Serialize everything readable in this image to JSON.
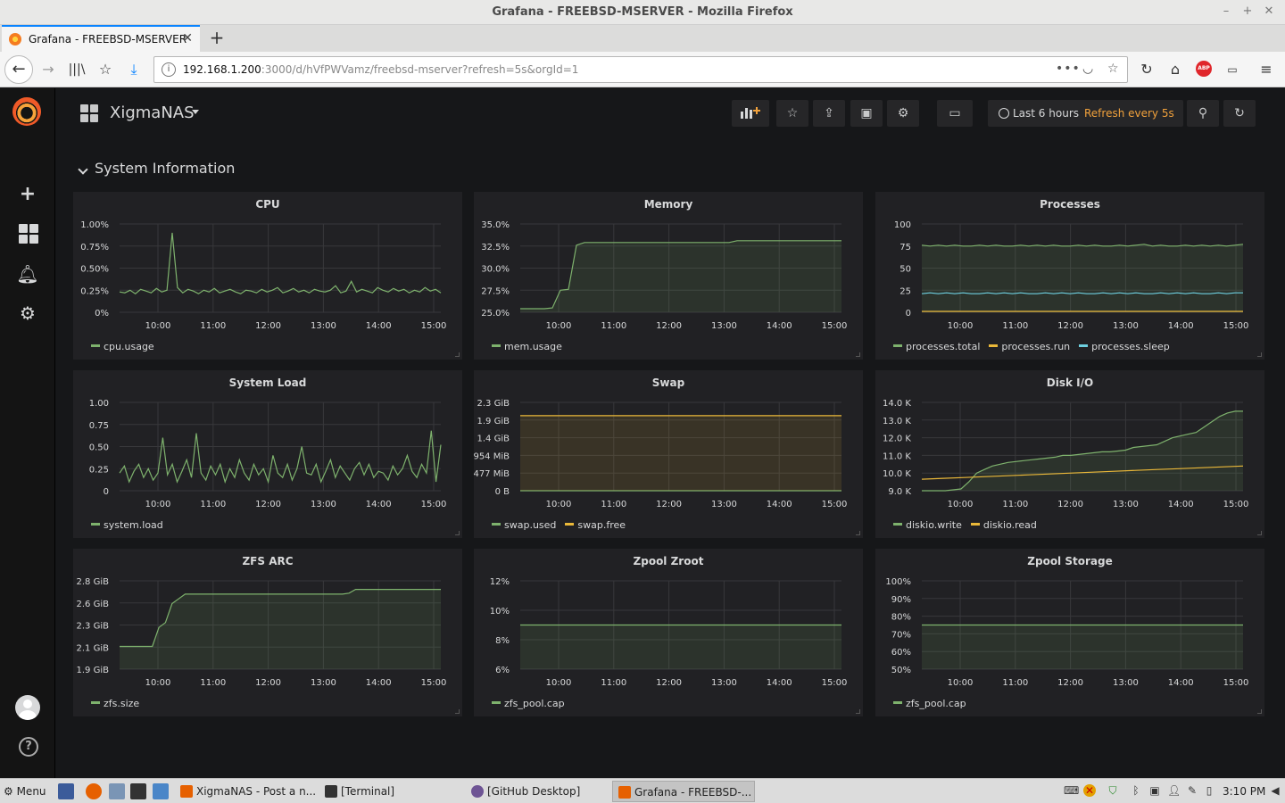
{
  "window": {
    "title": "Grafana - FREEBSD-MSERVER - Mozilla Firefox"
  },
  "tab": {
    "label": "Grafana - FREEBSD-MSERVER"
  },
  "url": {
    "host": "192.168.1.200",
    "rest": ":3000/d/hVfPWVamz/freebsd-mserver?refresh=5s&orgId=1"
  },
  "dashboard": {
    "title": "XigmaNAS",
    "time_range": "Last 6 hours",
    "refresh": "Refresh every 5s",
    "row_title": "System Information"
  },
  "time_ticks": [
    "10:00",
    "11:00",
    "12:00",
    "13:00",
    "14:00",
    "15:00"
  ],
  "panels": [
    {
      "title": "CPU",
      "legend": [
        "cpu.usage"
      ],
      "chart_data": {
        "type": "line",
        "y_ticks": [
          "1.00%",
          "0.75%",
          "0.50%",
          "0.25%",
          "0%"
        ],
        "ylim": [
          0,
          1.0
        ],
        "series": [
          {
            "name": "cpu.usage",
            "color": "#7eb26d",
            "fill": false,
            "values": [
              0.23,
              0.22,
              0.25,
              0.21,
              0.26,
              0.24,
              0.22,
              0.27,
              0.23,
              0.25,
              0.9,
              0.28,
              0.22,
              0.26,
              0.24,
              0.21,
              0.25,
              0.23,
              0.27,
              0.22,
              0.24,
              0.26,
              0.23,
              0.21,
              0.25,
              0.24,
              0.22,
              0.26,
              0.23,
              0.25,
              0.28,
              0.22,
              0.24,
              0.27,
              0.23,
              0.25,
              0.22,
              0.26,
              0.24,
              0.23,
              0.25,
              0.3,
              0.22,
              0.24,
              0.35,
              0.23,
              0.26,
              0.24,
              0.22,
              0.28,
              0.25,
              0.23,
              0.27,
              0.24,
              0.26,
              0.22,
              0.25,
              0.23,
              0.28,
              0.24,
              0.26,
              0.22
            ]
          }
        ]
      }
    },
    {
      "title": "Memory",
      "legend": [
        "mem.usage"
      ],
      "chart_data": {
        "type": "area",
        "y_ticks": [
          "35.0%",
          "32.5%",
          "30.0%",
          "27.5%",
          "25.0%"
        ],
        "ylim": [
          25,
          35
        ],
        "series": [
          {
            "name": "mem.usage",
            "color": "#7eb26d",
            "fill": true,
            "values": [
              25.4,
              25.4,
              25.4,
              25.4,
              25.5,
              27.5,
              27.6,
              32.6,
              32.9,
              32.9,
              32.9,
              32.9,
              32.9,
              32.9,
              32.9,
              32.9,
              32.9,
              32.9,
              32.9,
              32.9,
              32.9,
              32.9,
              32.9,
              32.9,
              32.9,
              32.9,
              32.9,
              33.1,
              33.1,
              33.1,
              33.1,
              33.1,
              33.1,
              33.1,
              33.1,
              33.1,
              33.1,
              33.1,
              33.1,
              33.1,
              33.1
            ]
          }
        ]
      }
    },
    {
      "title": "Processes",
      "legend": [
        "processes.total",
        "processes.run",
        "processes.sleep"
      ],
      "chart_data": {
        "type": "line",
        "y_ticks": [
          "100",
          "75",
          "50",
          "25",
          "0"
        ],
        "ylim": [
          0,
          100
        ],
        "series": [
          {
            "name": "processes.total",
            "color": "#7eb26d",
            "fill": true,
            "values": [
              76,
              75,
              76,
              75,
              76,
              75,
              75,
              76,
              75,
              76,
              75,
              75,
              76,
              75,
              76,
              75,
              76,
              75,
              75,
              76,
              75,
              76,
              75,
              75,
              76,
              75,
              76,
              77,
              75,
              76,
              75,
              75,
              76,
              75,
              76,
              75,
              76,
              75,
              76,
              77
            ]
          },
          {
            "name": "processes.run",
            "color": "#eab839",
            "fill": false,
            "values": [
              1,
              1,
              1,
              1,
              1,
              1,
              1,
              1,
              1,
              1,
              1,
              1,
              1,
              1,
              1,
              1,
              1,
              1,
              1,
              1,
              1,
              1,
              1,
              1,
              1,
              1,
              1,
              1,
              1,
              1,
              1,
              1,
              1,
              1,
              1,
              1,
              1,
              1,
              1,
              1
            ]
          },
          {
            "name": "processes.sleep",
            "color": "#6ed0e0",
            "fill": false,
            "values": [
              21,
              22,
              21,
              22,
              21,
              22,
              21,
              21,
              22,
              21,
              22,
              21,
              22,
              21,
              21,
              22,
              21,
              22,
              21,
              22,
              21,
              21,
              22,
              21,
              22,
              21,
              22,
              21,
              21,
              22,
              21,
              22,
              21,
              22,
              21,
              21,
              22,
              21,
              22,
              22
            ]
          }
        ]
      }
    },
    {
      "title": "System Load",
      "legend": [
        "system.load"
      ],
      "chart_data": {
        "type": "line",
        "y_ticks": [
          "1.00",
          "0.75",
          "0.50",
          "0.25",
          "0"
        ],
        "ylim": [
          0,
          1.0
        ],
        "series": [
          {
            "name": "system.load",
            "color": "#7eb26d",
            "fill": false,
            "values": [
              0.2,
              0.28,
              0.1,
              0.22,
              0.3,
              0.15,
              0.25,
              0.12,
              0.2,
              0.6,
              0.18,
              0.3,
              0.1,
              0.22,
              0.35,
              0.15,
              0.65,
              0.2,
              0.12,
              0.28,
              0.18,
              0.3,
              0.1,
              0.25,
              0.15,
              0.35,
              0.2,
              0.12,
              0.3,
              0.18,
              0.25,
              0.1,
              0.4,
              0.2,
              0.15,
              0.3,
              0.12,
              0.25,
              0.5,
              0.2,
              0.18,
              0.3,
              0.1,
              0.22,
              0.35,
              0.15,
              0.28,
              0.2,
              0.12,
              0.25,
              0.32,
              0.18,
              0.3,
              0.15,
              0.22,
              0.2,
              0.12,
              0.28,
              0.18,
              0.25,
              0.4,
              0.22,
              0.15,
              0.3,
              0.2,
              0.68,
              0.1,
              0.52
            ]
          }
        ]
      }
    },
    {
      "title": "Swap",
      "legend": [
        "swap.used",
        "swap.free"
      ],
      "chart_data": {
        "type": "area",
        "y_ticks": [
          "2.3 GiB",
          "1.9 GiB",
          "1.4 GiB",
          "954 MiB",
          "477 MiB",
          "0 B"
        ],
        "ylim": [
          0,
          2.33
        ],
        "series": [
          {
            "name": "swap.used",
            "color": "#7eb26d",
            "fill": false,
            "values": [
              0,
              0,
              0,
              0,
              0,
              0,
              0,
              0,
              0,
              0
            ]
          },
          {
            "name": "swap.free",
            "color": "#eab839",
            "fill": true,
            "values": [
              1.98,
              1.98,
              1.98,
              1.98,
              1.98,
              1.98,
              1.98,
              1.98,
              1.98,
              1.98
            ]
          }
        ]
      }
    },
    {
      "title": "Disk I/O",
      "legend": [
        "diskio.write",
        "diskio.read"
      ],
      "chart_data": {
        "type": "area",
        "y_ticks": [
          "14.0 K",
          "13.0 K",
          "12.0 K",
          "11.0 K",
          "10.0 K",
          "9.0 K"
        ],
        "ylim": [
          9000,
          14000
        ],
        "series": [
          {
            "name": "diskio.write",
            "color": "#7eb26d",
            "fill": true,
            "values": [
              9000,
              9000,
              9000,
              9000,
              9050,
              9100,
              9500,
              10000,
              10200,
              10400,
              10500,
              10600,
              10650,
              10700,
              10750,
              10800,
              10850,
              10900,
              11000,
              11000,
              11050,
              11100,
              11150,
              11200,
              11200,
              11250,
              11300,
              11450,
              11500,
              11550,
              11600,
              11800,
              12000,
              12100,
              12200,
              12300,
              12600,
              12900,
              13200,
              13400,
              13500,
              13500
            ]
          },
          {
            "name": "diskio.read",
            "color": "#eab839",
            "fill": false,
            "values": [
              9650,
              9700,
              9750,
              9800,
              9850,
              9900,
              9950,
              10000,
              10050,
              10100,
              10150,
              10200,
              10250,
              10300,
              10350,
              10400
            ]
          }
        ]
      }
    },
    {
      "title": "ZFS ARC",
      "legend": [
        "zfs.size"
      ],
      "chart_data": {
        "type": "area",
        "y_ticks": [
          "2.8 GiB",
          "2.6 GiB",
          "2.3 GiB",
          "2.1 GiB",
          "1.9 GiB"
        ],
        "ylim": [
          1.86,
          2.79
        ],
        "series": [
          {
            "name": "zfs.size",
            "color": "#7eb26d",
            "fill": true,
            "values": [
              2.1,
              2.1,
              2.1,
              2.1,
              2.1,
              2.1,
              2.3,
              2.35,
              2.55,
              2.6,
              2.65,
              2.65,
              2.65,
              2.65,
              2.65,
              2.65,
              2.65,
              2.65,
              2.65,
              2.65,
              2.65,
              2.65,
              2.65,
              2.65,
              2.65,
              2.65,
              2.65,
              2.65,
              2.65,
              2.65,
              2.65,
              2.65,
              2.65,
              2.65,
              2.65,
              2.66,
              2.7,
              2.7,
              2.7,
              2.7,
              2.7,
              2.7,
              2.7,
              2.7,
              2.7,
              2.7,
              2.7,
              2.7,
              2.7,
              2.7
            ]
          }
        ]
      }
    },
    {
      "title": "Zpool Zroot",
      "legend": [
        "zfs_pool.cap"
      ],
      "chart_data": {
        "type": "area",
        "y_ticks": [
          "12%",
          "10%",
          "8%",
          "6%"
        ],
        "ylim": [
          6,
          12
        ],
        "series": [
          {
            "name": "zfs_pool.cap",
            "color": "#7eb26d",
            "fill": true,
            "values": [
              9,
              9,
              9,
              9,
              9,
              9,
              9,
              9,
              9,
              9
            ]
          }
        ]
      }
    },
    {
      "title": "Zpool Storage",
      "legend": [
        "zfs_pool.cap"
      ],
      "chart_data": {
        "type": "area",
        "y_ticks": [
          "100%",
          "90%",
          "80%",
          "70%",
          "60%",
          "50%"
        ],
        "ylim": [
          50,
          100
        ],
        "series": [
          {
            "name": "zfs_pool.cap",
            "color": "#7eb26d",
            "fill": true,
            "values": [
              75,
              75,
              75,
              75,
              75,
              75,
              75,
              75,
              75,
              75
            ]
          }
        ]
      }
    }
  ],
  "taskbar": {
    "menu": "Menu",
    "tasks": [
      "XigmaNAS - Post a n...",
      "[Terminal]",
      "[GitHub Desktop]",
      "Grafana - FREEBSD-..."
    ],
    "clock": "3:10 PM"
  }
}
